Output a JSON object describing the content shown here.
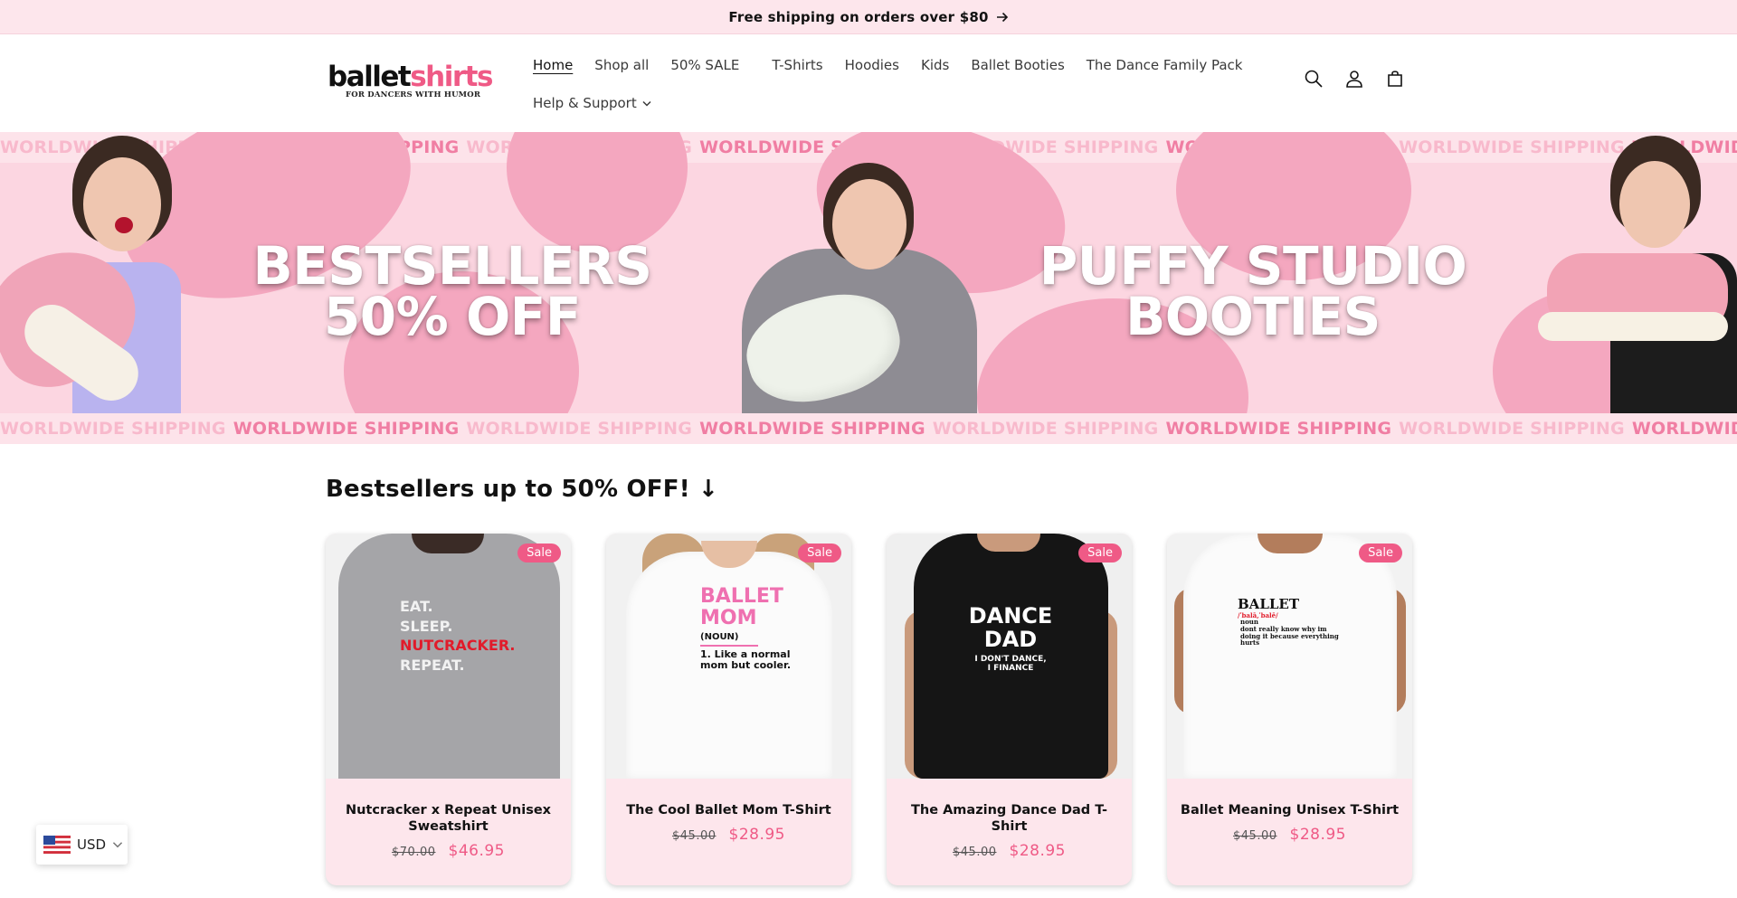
{
  "announcement": {
    "text": "Free shipping on orders over $80",
    "icon": "arrow-right-icon"
  },
  "logo": {
    "part1": "ballet",
    "part2": "shirts",
    "tagline": "FOR DANCERS WITH HUMOR"
  },
  "nav": {
    "items": [
      {
        "label": "Home",
        "active": true
      },
      {
        "label": "Shop all"
      },
      {
        "label": "50% SALE"
      },
      {
        "label": "T-Shirts"
      },
      {
        "label": "Hoodies"
      },
      {
        "label": "Kids"
      },
      {
        "label": "Ballet Booties"
      },
      {
        "label": "The Dance Family Pack"
      }
    ],
    "support": {
      "label": "Help & Support",
      "icon": "chevron-down-icon"
    }
  },
  "header_icons": [
    "search-icon",
    "account-icon",
    "cart-icon"
  ],
  "banner": {
    "marquee_text": "WORLDWIDE SHIPPING",
    "left_headline_line1": "BESTSELLERS",
    "left_headline_line2": "50% OFF",
    "right_headline_line1": "PUFFY STUDIO",
    "right_headline_line2": "BOOTIES"
  },
  "section": {
    "title": "Bestsellers up to 50% OFF! ↓"
  },
  "products": [
    {
      "title": "Nutcracker x Repeat Unisex Sweatshirt",
      "badge": "Sale",
      "price_old": "$70.00",
      "price_new": "$46.95",
      "print_lines": [
        "EAT.",
        "SLEEP.",
        "NUTCRACKER.",
        "REPEAT."
      ]
    },
    {
      "title": "The Cool Ballet Mom T-Shirt",
      "badge": "Sale",
      "price_old": "$45.00",
      "price_new": "$28.95",
      "print_lines": [
        "BALLET",
        "MOM",
        "(NOUN)",
        "1. Like a normal",
        "mom but cooler."
      ]
    },
    {
      "title": "The Amazing Dance Dad T-Shirt",
      "badge": "Sale",
      "price_old": "$45.00",
      "price_new": "$28.95",
      "print_lines": [
        "DANCE",
        "DAD",
        "I DON'T DANCE,",
        "I FINANCE"
      ]
    },
    {
      "title": "Ballet Meaning Unisex T-Shirt",
      "badge": "Sale",
      "price_old": "$45.00",
      "price_new": "$28.95",
      "print_lines": [
        "BALLET",
        "/ˈbalā,ˈbalē/",
        "noun",
        "dont really know why im",
        "doing it because everything",
        "hurts"
      ]
    }
  ],
  "currency": {
    "code": "USD",
    "flag_icon": "us-flag-icon"
  },
  "colors": {
    "accent": "#ef5a86",
    "announcement_bg": "#fde6ec",
    "banner_bg": "#fcd6e1",
    "card_bg": "#fde6ec"
  }
}
